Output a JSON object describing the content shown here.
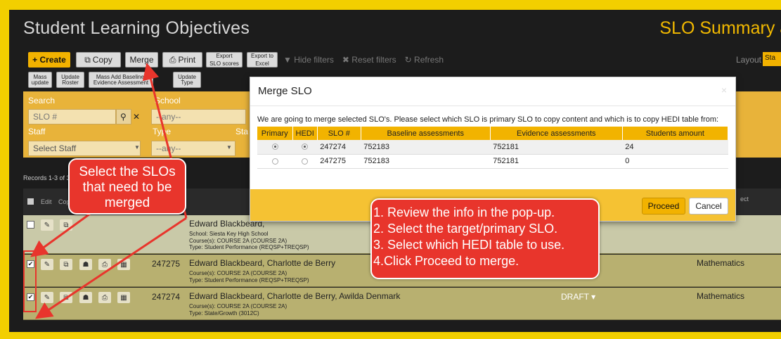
{
  "header": {
    "title": "Student Learning Objectives",
    "title_right": "SLO Summary and"
  },
  "toolbar": {
    "create": "+ Create",
    "copy": "Copy",
    "merge": "Merge",
    "print": "Print",
    "export_scores_1": "Export",
    "export_scores_2": "SLO scores",
    "export_excel_1": "Export to",
    "export_excel_2": "Excel",
    "hide_filters": "▼ Hide filters",
    "reset_filters": "✖ Reset filters",
    "refresh": "↻ Refresh",
    "layout": "Layout",
    "layout_tag": "Sta"
  },
  "toolbar2": {
    "mass_update_1": "Mass",
    "mass_update_2": "update",
    "update_roster_1": "Update",
    "update_roster_2": "Roster",
    "mass_add_1": "Mass Add Baseline/",
    "mass_add_2": "Evidence Assessment",
    "update_type_1": "Update",
    "update_type_2": "Type"
  },
  "filters": {
    "search_label": "Search",
    "search_placeholder": "SLO #",
    "school_label": "School",
    "school_value": "--any--",
    "staff_label": "Staff",
    "staff_value": "Select Staff",
    "type_label": "Type",
    "type_value": "--any--",
    "sta_label": "Sta"
  },
  "records": "Records 1-3 of 3",
  "table_head": {
    "edit": "Edit",
    "copy": "Cop",
    "subject": "ect"
  },
  "rows": [
    {
      "id": "",
      "name": "Edward Blackbeard,",
      "school": "School: Siesta Key High School",
      "course": "Course(s): COURSE 2A (COURSE 2A)",
      "type": "Type: Student Performance (REQSP+TREQSP)",
      "status": "",
      "subject": ""
    },
    {
      "id": "247275",
      "name": "Edward Blackbeard, Charlotte de Berry",
      "course": "Course(s): COURSE 2A (COURSE 2A)",
      "type": "Type: Student Performance (REQSP+TREQSP)",
      "status": "",
      "subject": "Mathematics"
    },
    {
      "id": "247274",
      "name": "Edward Blackbeard, Charlotte de Berry, Awilda Denmark",
      "course": "Course(s): COURSE 2A (COURSE 2A)",
      "type": "Type: State/Growth (3012C)",
      "status": "DRAFT ▾",
      "subject": "Mathematics"
    }
  ],
  "modal": {
    "title": "Merge SLO",
    "close": "×",
    "text": "We are going to merge selected SLO's. Please select which SLO is primary SLO to copy content and which is to copy HEDI table from:",
    "columns": [
      "Primary",
      "HEDI",
      "SLO #",
      "Baseline assessments",
      "Evidence assessments",
      "Students amount"
    ],
    "rows": [
      {
        "slo": "247274",
        "baseline": "752183",
        "evidence": "752181",
        "students": "24",
        "primary": true,
        "hedi": true
      },
      {
        "slo": "247275",
        "baseline": "752183",
        "evidence": "752181",
        "students": "0",
        "primary": false,
        "hedi": false
      }
    ],
    "proceed": "Proceed",
    "cancel": "Cancel"
  },
  "callouts": {
    "left": [
      "Select the SLOs",
      "that need to be",
      "merged"
    ],
    "right": [
      "1. Review the info in the pop-up.",
      "2. Select the target/primary SLO.",
      "3. Select which HEDI table to use.",
      "4.Click Proceed to merge."
    ]
  },
  "colors": {
    "accent": "#f2b200",
    "callout": "#e8352c",
    "frame": "#f2cf00"
  }
}
